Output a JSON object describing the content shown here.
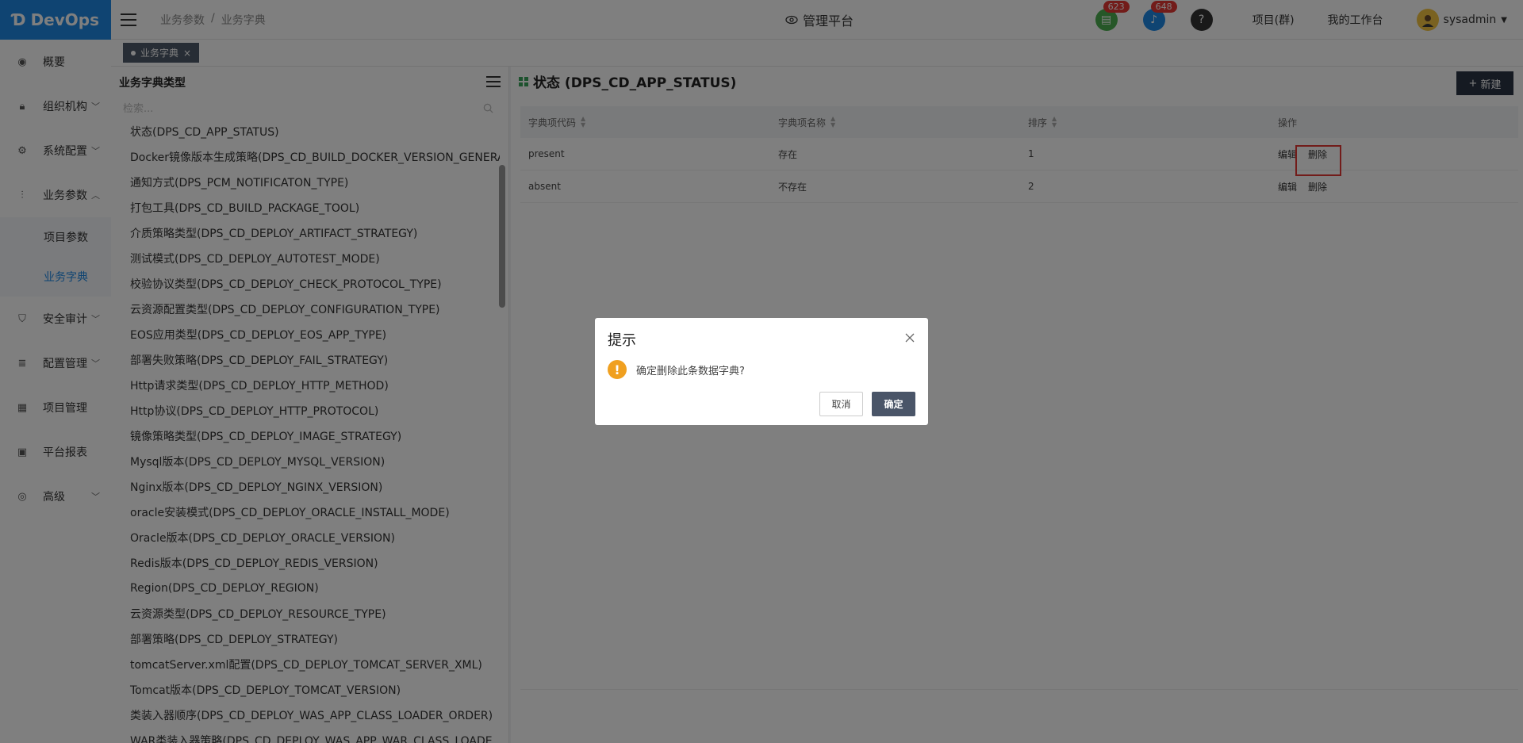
{
  "app": {
    "logo_text": "DevOps"
  },
  "sidebar": {
    "items": [
      {
        "label": "概要",
        "icon": "dashboard-icon"
      },
      {
        "label": "组织机构",
        "icon": "lock-icon",
        "expandable": true
      },
      {
        "label": "系统配置",
        "icon": "gear-icon",
        "expandable": true
      },
      {
        "label": "业务参数",
        "icon": "sliders-icon",
        "expandable": true,
        "expanded": true
      },
      {
        "label": "项目参数",
        "sub": true
      },
      {
        "label": "业务字典",
        "sub": true,
        "active": true
      },
      {
        "label": "安全审计",
        "icon": "shield-icon",
        "expandable": true
      },
      {
        "label": "配置管理",
        "icon": "database-icon",
        "expandable": true
      },
      {
        "label": "项目管理",
        "icon": "grid-icon"
      },
      {
        "label": "平台报表",
        "icon": "monitor-icon"
      },
      {
        "label": "高级",
        "icon": "fingerprint-icon",
        "expandable": true
      }
    ]
  },
  "header": {
    "breadcrumb": [
      "业务参数",
      "/",
      "业务字典"
    ],
    "platform_label": "管理平台",
    "task_badge": "623",
    "notification_badge": "648",
    "help_label": "?",
    "project_group_label": "项目(群)",
    "workbench_label": "我的工作台",
    "username": "sysadmin"
  },
  "tabs": [
    {
      "label": "业务字典",
      "close": "×"
    }
  ],
  "left_panel": {
    "title": "业务字典类型",
    "search_placeholder": "检索...",
    "items": [
      "状态(DPS_CD_APP_STATUS)",
      "Docker镜像版本生成策略(DPS_CD_BUILD_DOCKER_VERSION_GENERA",
      "通知方式(DPS_PCM_NOTIFICATON_TYPE)",
      "打包工具(DPS_CD_BUILD_PACKAGE_TOOL)",
      "介质策略类型(DPS_CD_DEPLOY_ARTIFACT_STRATEGY)",
      "测试模式(DPS_CD_DEPLOY_AUTOTEST_MODE)",
      "校验协议类型(DPS_CD_DEPLOY_CHECK_PROTOCOL_TYPE)",
      "云资源配置类型(DPS_CD_DEPLOY_CONFIGURATION_TYPE)",
      "EOS应用类型(DPS_CD_DEPLOY_EOS_APP_TYPE)",
      "部署失败策略(DPS_CD_DEPLOY_FAIL_STRATEGY)",
      "Http请求类型(DPS_CD_DEPLOY_HTTP_METHOD)",
      "Http协议(DPS_CD_DEPLOY_HTTP_PROTOCOL)",
      "镜像策略类型(DPS_CD_DEPLOY_IMAGE_STRATEGY)",
      "Mysql版本(DPS_CD_DEPLOY_MYSQL_VERSION)",
      "Nginx版本(DPS_CD_DEPLOY_NGINX_VERSION)",
      "oracle安装模式(DPS_CD_DEPLOY_ORACLE_INSTALL_MODE)",
      "Oracle版本(DPS_CD_DEPLOY_ORACLE_VERSION)",
      "Redis版本(DPS_CD_DEPLOY_REDIS_VERSION)",
      "Region(DPS_CD_DEPLOY_REGION)",
      "云资源类型(DPS_CD_DEPLOY_RESOURCE_TYPE)",
      "部署策略(DPS_CD_DEPLOY_STRATEGY)",
      "tomcatServer.xml配置(DPS_CD_DEPLOY_TOMCAT_SERVER_XML)",
      "Tomcat版本(DPS_CD_DEPLOY_TOMCAT_VERSION)",
      "类装入器顺序(DPS_CD_DEPLOY_WAS_APP_CLASS_LOADER_ORDER)",
      "WAR类装入器策略(DPS_CD_DEPLOY_WAS_APP_WAR_CLASS_LOADE"
    ]
  },
  "main": {
    "title": "状态 (DPS_CD_APP_STATUS)",
    "new_button": "新建",
    "columns": [
      "字典项代码",
      "字典项名称",
      "排序",
      "操作"
    ],
    "rows": [
      {
        "code": "present",
        "name": "存在",
        "order": "1",
        "edit": "编辑",
        "delete": "删除"
      },
      {
        "code": "absent",
        "name": "不存在",
        "order": "2",
        "edit": "编辑",
        "delete": "删除"
      }
    ]
  },
  "dialog": {
    "title": "提示",
    "message": "确定删除此条数据字典?",
    "cancel": "取消",
    "confirm": "确定"
  },
  "colors": {
    "brand": "#1e88e5",
    "task_badge_bg": "#4caf50",
    "notification_bg": "#1e88e5",
    "badge_red": "#e53935",
    "warning": "#f0a020",
    "confirm_button": "#4a5568"
  }
}
